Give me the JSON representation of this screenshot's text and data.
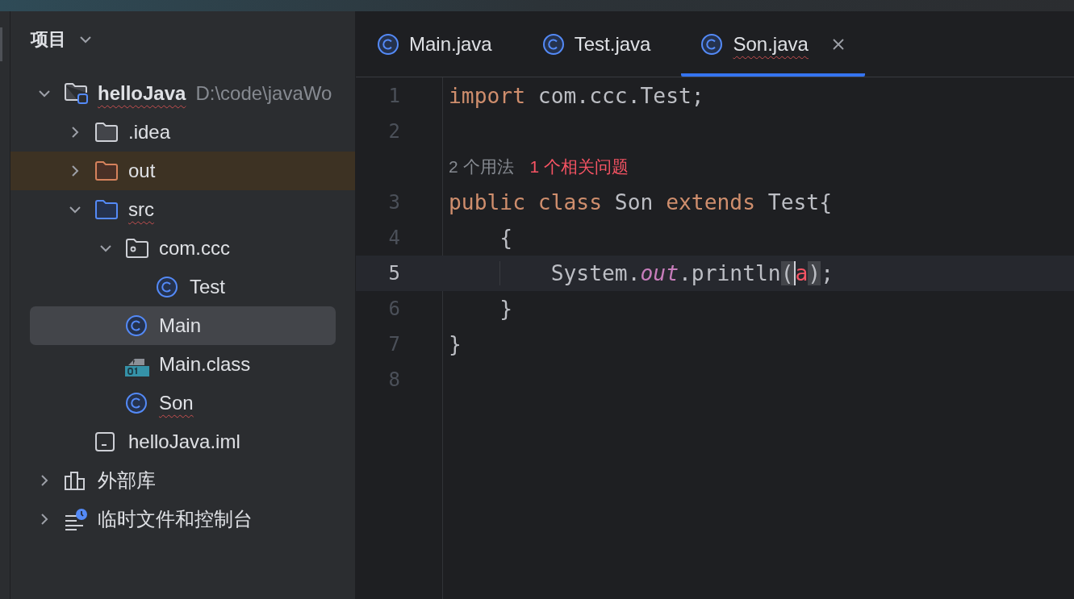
{
  "project_panel": {
    "title": "项目",
    "tree": [
      {
        "name": "helloJava",
        "path": "D:\\code\\javaWo",
        "kind": "module",
        "expanded": true,
        "selected": false,
        "typo": true,
        "children": [
          {
            "name": ".idea",
            "kind": "folder",
            "expanded": false,
            "selected": false,
            "typo": false
          },
          {
            "name": "out",
            "kind": "excluded",
            "expanded": false,
            "selected": false,
            "typo": false
          },
          {
            "name": "src",
            "kind": "source",
            "expanded": true,
            "selected": false,
            "typo": true,
            "children": [
              {
                "name": "com.ccc",
                "kind": "package",
                "expanded": true,
                "selected": false,
                "typo": false,
                "children": [
                  {
                    "name": "Test",
                    "kind": "class",
                    "selected": false,
                    "typo": false
                  }
                ]
              },
              {
                "name": "Main",
                "kind": "class",
                "selected": true,
                "typo": false
              },
              {
                "name": "Main.class",
                "kind": "classfile",
                "selected": false,
                "typo": false
              },
              {
                "name": "Son",
                "kind": "class",
                "selected": false,
                "typo": true
              }
            ]
          },
          {
            "name": "helloJava.iml",
            "kind": "iml",
            "selected": false,
            "typo": false
          }
        ]
      },
      {
        "name": "外部库",
        "kind": "library",
        "expanded": false,
        "selected": false,
        "typo": false
      },
      {
        "name": "临时文件和控制台",
        "kind": "scratches",
        "expanded": false,
        "selected": false,
        "typo": false
      }
    ]
  },
  "editor": {
    "tabs": [
      {
        "label": "Main.java",
        "selected": false,
        "typo": false
      },
      {
        "label": "Test.java",
        "selected": false,
        "typo": false
      },
      {
        "label": "Son.java",
        "selected": true,
        "typo": true
      }
    ],
    "lines": [
      {
        "kind": "code",
        "number": "1",
        "current": false,
        "tokens": [
          {
            "text": "import",
            "kind": "keyword"
          },
          {
            "text": " com.ccc.Test;",
            "kind": "plain"
          }
        ]
      },
      {
        "kind": "code",
        "number": "2",
        "current": false
      },
      {
        "kind": "hint",
        "parts": [
          {
            "text": "2 个用法",
            "kind": "usages"
          },
          {
            "text": "1 个相关问题",
            "kind": "problems"
          }
        ]
      },
      {
        "kind": "code",
        "number": "3",
        "current": false,
        "tokens": [
          {
            "text": "public",
            "kind": "keyword"
          },
          {
            "text": " class",
            "kind": "keyword"
          },
          {
            "text": " Son ",
            "kind": "plain"
          },
          {
            "text": "extends",
            "kind": "keyword"
          },
          {
            "text": " Test{",
            "kind": "plain"
          }
        ]
      },
      {
        "kind": "code",
        "number": "4",
        "current": false,
        "tokens": [
          {
            "text": "    {",
            "kind": "plain"
          }
        ]
      },
      {
        "kind": "code",
        "number": "5",
        "current": true,
        "tokens": [
          {
            "text": "        System.",
            "kind": "plain"
          },
          {
            "text": "out",
            "kind": "static"
          },
          {
            "text": ".println",
            "kind": "plain"
          },
          {
            "text": "(",
            "kind": "brace"
          },
          {
            "text": "a",
            "kind": "error",
            "caret": true
          },
          {
            "text": ")",
            "kind": "brace"
          },
          {
            "text": ";",
            "kind": "plain"
          }
        ]
      },
      {
        "kind": "code",
        "number": "6",
        "current": false,
        "tokens": [
          {
            "text": "    }",
            "kind": "plain"
          }
        ]
      },
      {
        "kind": "code",
        "number": "7",
        "current": false,
        "tokens": [
          {
            "text": "}",
            "kind": "plain"
          }
        ]
      },
      {
        "kind": "code",
        "number": "8",
        "current": false
      }
    ]
  }
}
